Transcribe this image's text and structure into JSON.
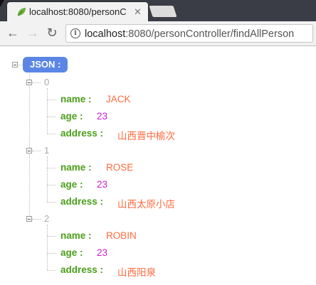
{
  "browser": {
    "tab_title": "localhost:8080/personC",
    "url_host": "localhost",
    "url_rest": ":8080/personController/findAllPerson",
    "icons": [
      "leaf-favicon",
      "close-icon",
      "back-icon",
      "forward-icon",
      "reload-icon",
      "info-icon"
    ]
  },
  "json_view": {
    "root_label": "JSON :",
    "colors": {
      "key": "#4a9e1a",
      "string": "#ff6a3d",
      "number": "#c81ecc",
      "badge": "#5b86e5"
    },
    "items": [
      {
        "index": "0",
        "fields": [
          {
            "key": "name :",
            "value": "JACK",
            "type": "string"
          },
          {
            "key": "age :",
            "value": "23",
            "type": "number"
          },
          {
            "key": "address :",
            "value": "山西晋中榆次",
            "type": "string"
          }
        ]
      },
      {
        "index": "1",
        "fields": [
          {
            "key": "name :",
            "value": "ROSE",
            "type": "string"
          },
          {
            "key": "age :",
            "value": "23",
            "type": "number"
          },
          {
            "key": "address :",
            "value": "山西太原小店",
            "type": "string"
          }
        ]
      },
      {
        "index": "2",
        "fields": [
          {
            "key": "name :",
            "value": "ROBIN",
            "type": "string"
          },
          {
            "key": "age :",
            "value": "23",
            "type": "number"
          },
          {
            "key": "address :",
            "value": "山西阳泉",
            "type": "string"
          }
        ]
      }
    ]
  }
}
